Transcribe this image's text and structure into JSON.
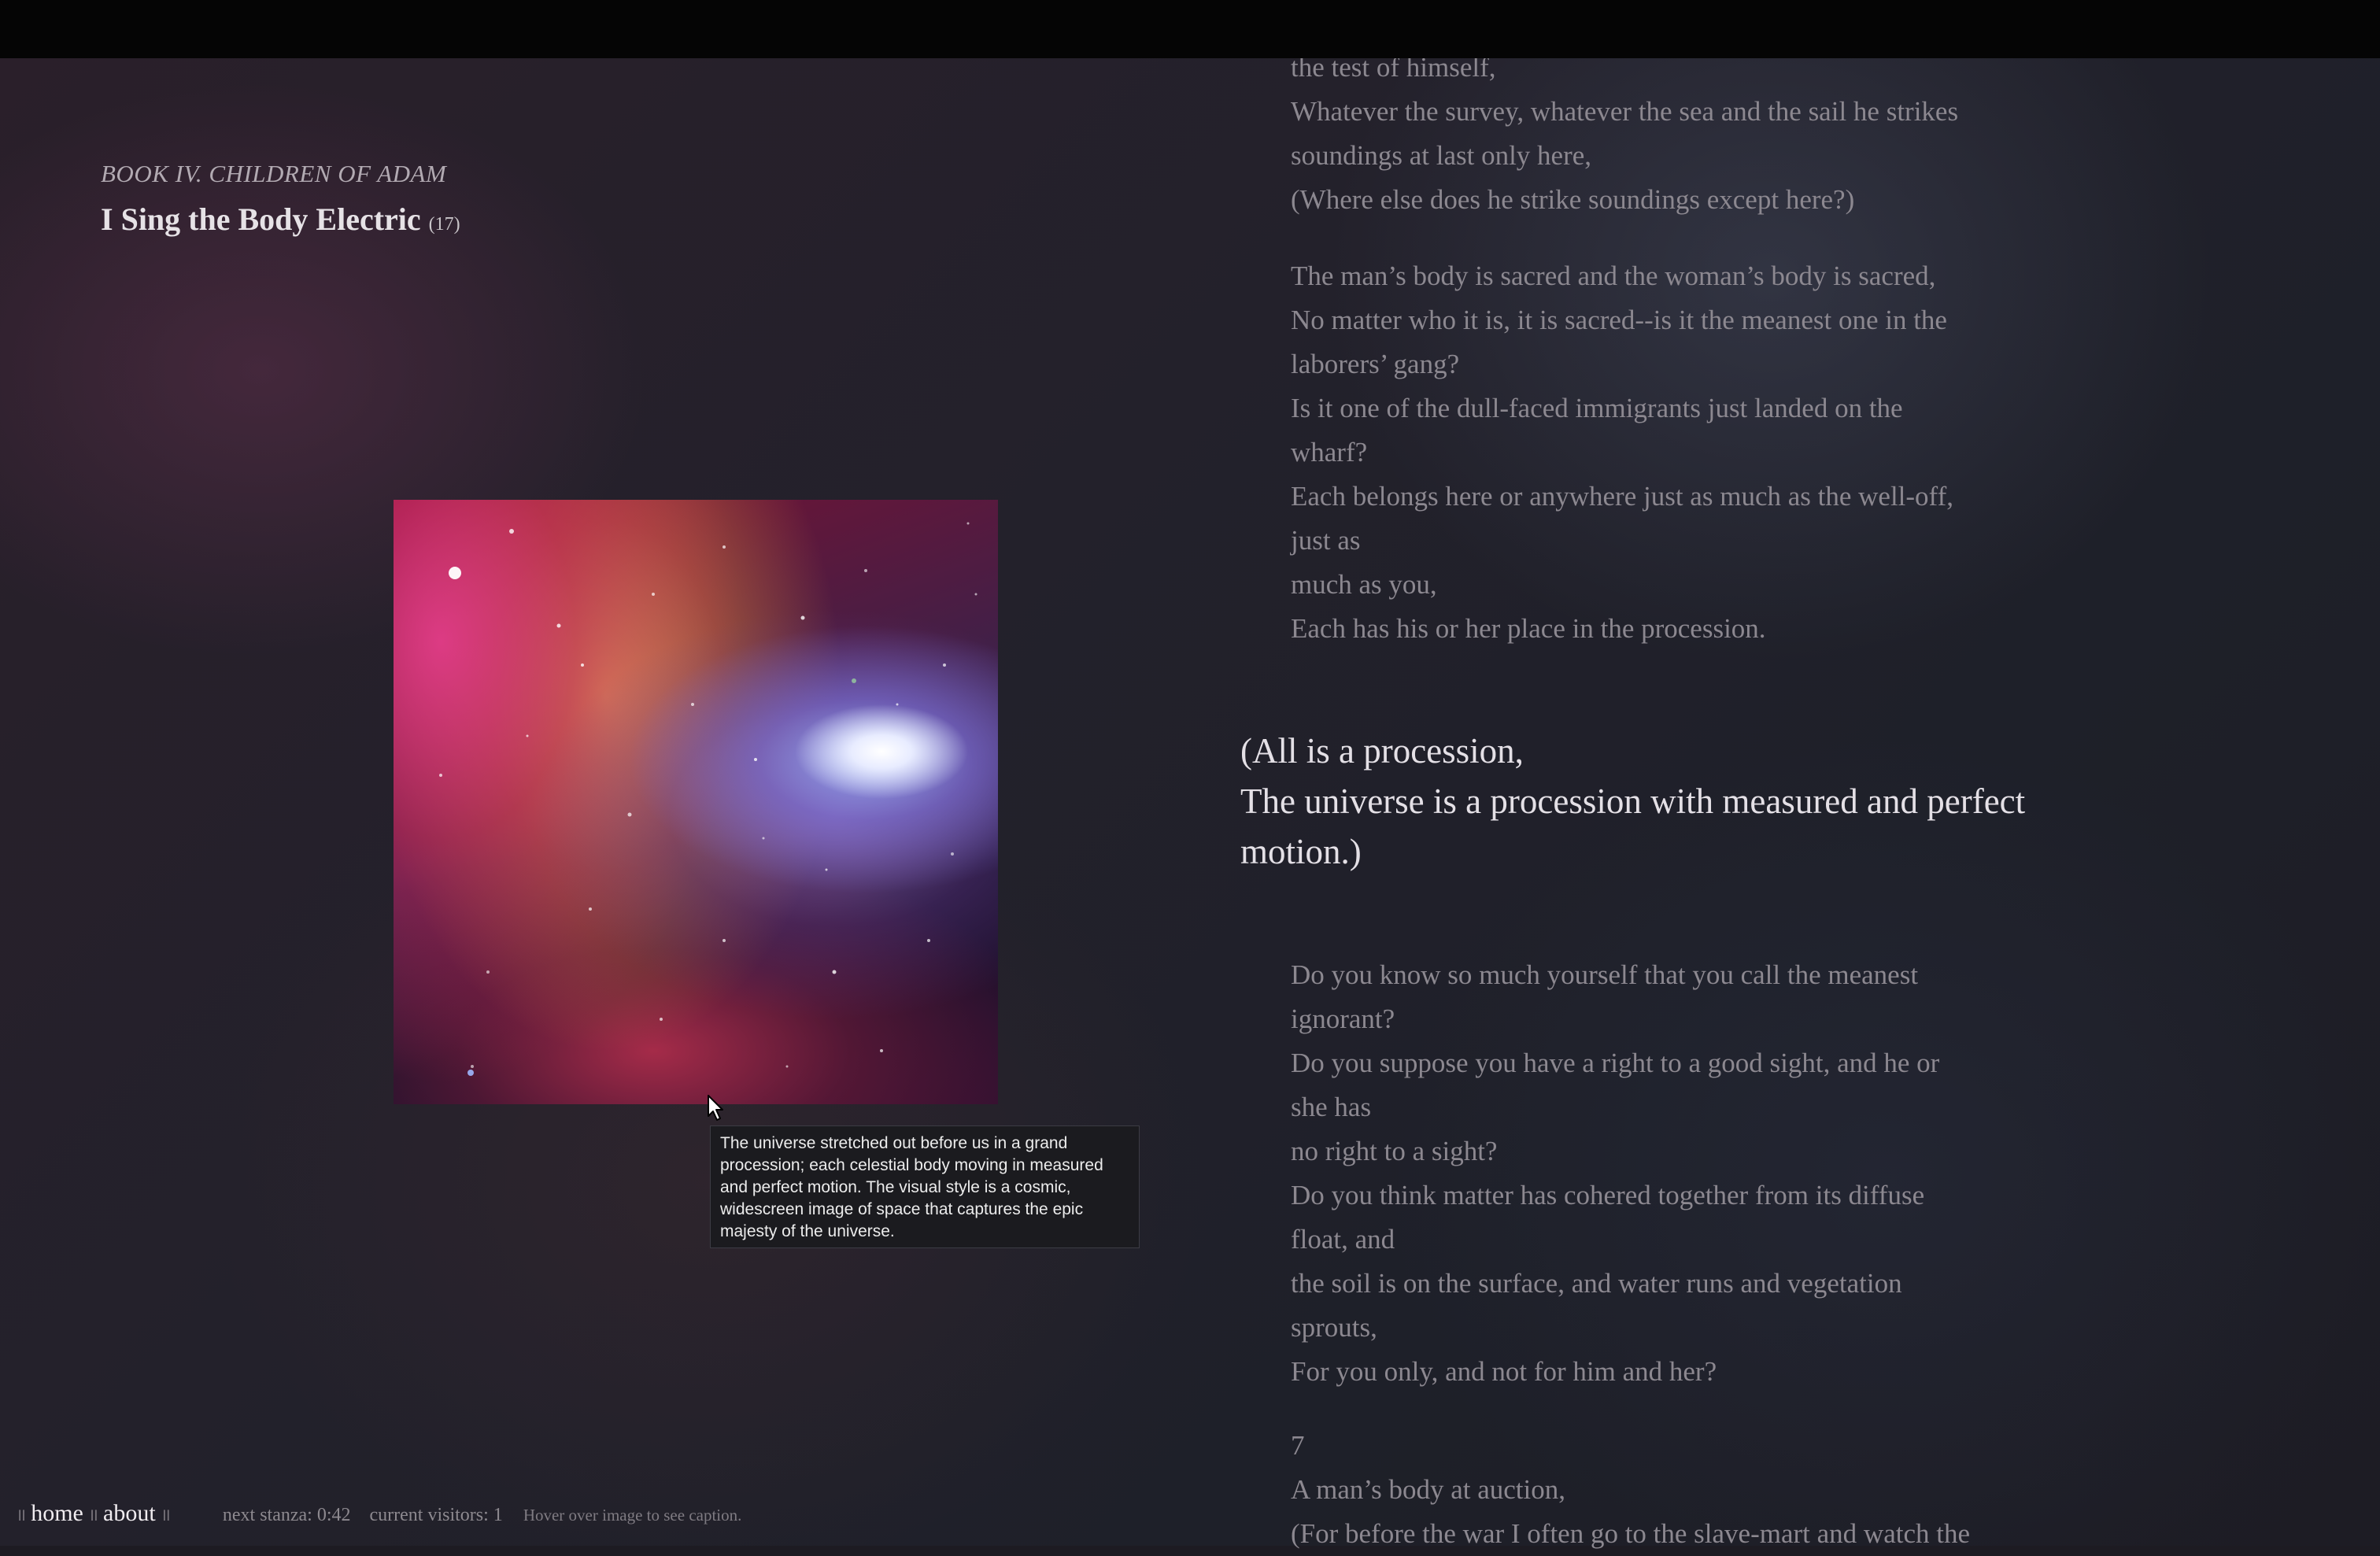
{
  "header": {
    "book": "BOOK IV. CHILDREN OF ADAM",
    "title": "I Sing the Body Electric",
    "number": "(17)"
  },
  "image": {
    "icon": "galaxy-image",
    "caption": "The universe stretched out before us in a grand procession; each celestial body moving in measured and perfect motion. The visual style is a cosmic, widescreen image of space that captures the epic majesty of the universe."
  },
  "poem": {
    "stanza1": [
      "the test of himself,",
      "Whatever the survey, whatever the sea and the sail he strikes",
      "soundings at last only here,",
      "(Where else does he strike soundings except here?)"
    ],
    "stanza2": [
      "The man’s body is sacred and the woman’s body is sacred,",
      "No matter who it is, it is sacred--is it the meanest one in the",
      "laborers’ gang?",
      "Is it one of the dull-faced immigrants just landed on the",
      "wharf?",
      "Each belongs here or anywhere just as much as the well-off,",
      "just as",
      "much as you,",
      "Each has his or her place in the procession."
    ],
    "highlight": [
      "(All is a procession,",
      "The universe is a procession with measured and perfect",
      "motion.)"
    ],
    "stanza3": [
      "Do you know so much yourself that you call the meanest",
      "ignorant?",
      "Do you suppose you have a right to a good sight, and he or",
      "she has",
      "no right to a sight?",
      "Do you think matter has cohered together from its diffuse",
      "float, and",
      "the soil is on the surface, and water runs and vegetation",
      "sprouts,",
      "For you only, and not for him and her?"
    ],
    "stanza4": [
      "7",
      "A man’s body at auction,",
      "(For before the war I often go to the slave-mart and watch the"
    ]
  },
  "footer": {
    "separator": "॥",
    "home": "home",
    "about": "about",
    "next_stanza": "next stanza: 0:42",
    "visitors": "current visitors: 1",
    "hint": "Hover over image to see caption."
  },
  "colors": {
    "highlight_text": "#e4e0e6",
    "stanza_text": "#8c8890",
    "top_bar": "#050505"
  }
}
